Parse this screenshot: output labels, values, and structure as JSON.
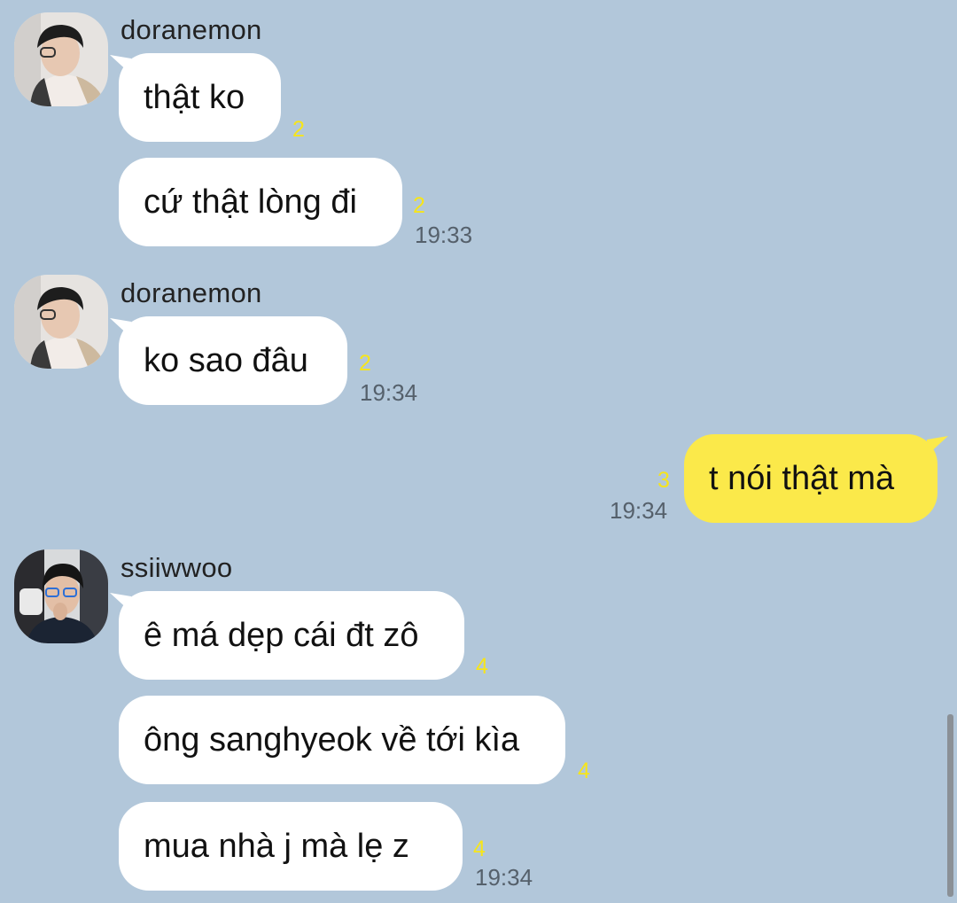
{
  "messages": [
    {
      "sender": "doranemon",
      "text": "thật ko",
      "unread": "2",
      "time": ""
    },
    {
      "sender": "",
      "text": "cứ thật lòng đi",
      "unread": "2",
      "time": "19:33"
    },
    {
      "sender": "doranemon",
      "text": "ko sao đâu",
      "unread": "2",
      "time": "19:34"
    },
    {
      "sender": "",
      "text": "t nói thật mà",
      "unread": "3",
      "time": "19:34"
    },
    {
      "sender": "ssiiwwoo",
      "text": "ê má dẹp cái đt zô",
      "unread": "4",
      "time": ""
    },
    {
      "sender": "",
      "text": "ông sanghyeok về tới kìa",
      "unread": "4",
      "time": ""
    },
    {
      "sender": "",
      "text": "mua nhà j mà lẹ z",
      "unread": "4",
      "time": "19:34"
    }
  ],
  "colors": {
    "background": "#b2c7da",
    "incoming_bubble": "#ffffff",
    "outgoing_bubble": "#fbe94a",
    "unread_count": "#f6e51b",
    "timestamp": "#55606b"
  },
  "icons": [
    "avatar-doranemon",
    "avatar-ssiiwwoo"
  ]
}
